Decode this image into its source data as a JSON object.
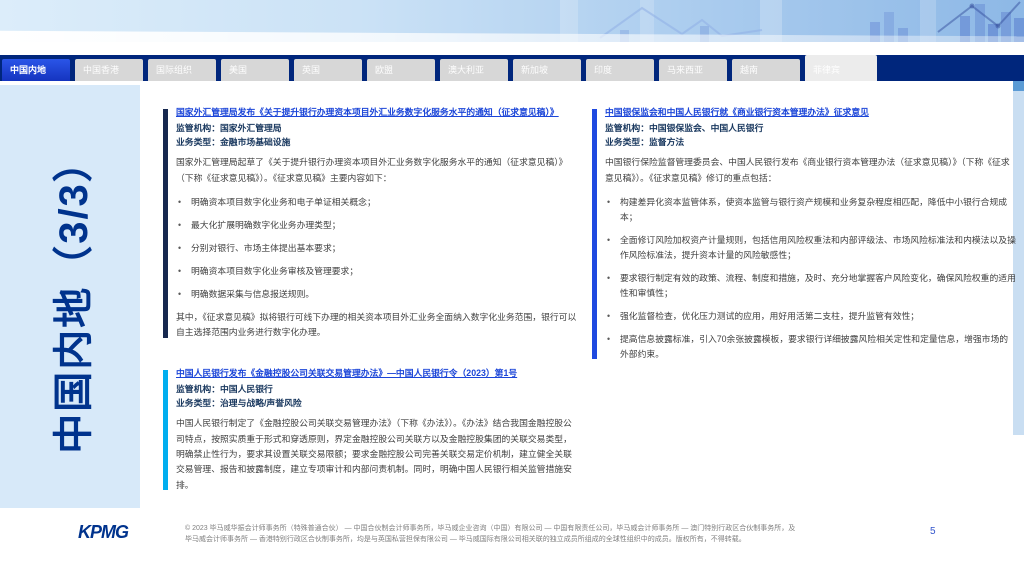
{
  "page": {
    "title_vertical": "中国内地（3/3）"
  },
  "tabs": [
    {
      "label": "中国内地",
      "active": true
    },
    {
      "label": "中国香港"
    },
    {
      "label": "国际组织"
    },
    {
      "label": "美国"
    },
    {
      "label": "英国"
    },
    {
      "label": "欧盟"
    },
    {
      "label": "澳大利亚"
    },
    {
      "label": "新加坡"
    },
    {
      "label": "印度"
    },
    {
      "label": "马来西亚"
    },
    {
      "label": "越南"
    },
    {
      "label": "菲律宾"
    }
  ],
  "labels": {
    "regulator": "监管机构：",
    "type": "业务类型："
  },
  "articles": {
    "left": [
      {
        "title": "国家外汇管理局发布《关于提升银行办理资本项目外汇业务数字化服务水平的通知（征求意见稿）》",
        "regulator": "国家外汇管理局",
        "type": "金融市场基础设施",
        "intro": "国家外汇管理局起草了《关于提升银行办理资本项目外汇业务数字化服务水平的通知（征求意见稿）》（下称《征求意见稿》）。《征求意见稿》主要内容如下：",
        "bullets": [
          "明确资本项目数字化业务和电子单证相关概念；",
          "最大化扩展明确数字化业务办理类型；",
          "分别对银行、市场主体提出基本要求；",
          "明确资本项目数字化业务审核及管理要求；",
          "明确数据采集与信息报送规则。"
        ],
        "outro": "其中，《征求意见稿》拟将银行可线下办理的相关资本项目外汇业务全面纳入数字化业务范围，银行可以自主选择范围内业务进行数字化办理。",
        "accent_color": "#16284f"
      },
      {
        "title": "中国人民银行发布《金融控股公司关联交易管理办法》—中国人民银行令（2023）第1号",
        "regulator": "中国人民银行",
        "type": "治理与战略/声誉风险",
        "intro": "中国人民银行制定了《金融控股公司关联交易管理办法》（下称《办法》）。《办法》结合我国金融控股公司特点，按照实质重于形式和穿透原则，界定金融控股公司关联方以及金融控股集团的关联交易类型，明确禁止性行为，要求其设置关联交易限额；要求金融控股公司完善关联交易定价机制，建立健全关联交易管理、报告和披露制度，建立专项审计和内部问责机制。同时，明确中国人民银行相关监管措施安排。",
        "accent_color": "#00aeef"
      }
    ],
    "right": [
      {
        "title": "中国银保监会和中国人民银行就《商业银行资本管理办法》征求意见",
        "regulator": "中国银保监会、中国人民银行",
        "type": "监督方法",
        "intro": "中国银行保险监督管理委员会、中国人民银行发布《商业银行资本管理办法（征求意见稿）》（下称《征求意见稿》）。《征求意见稿》修订的重点包括：",
        "bullets": [
          "构建差异化资本监管体系，使资本监管与银行资产规模和业务复杂程度相匹配，降低中小银行合规成本；",
          "全面修订风险加权资产计量规则，包括信用风险权重法和内部评级法、市场风险标准法和内模法以及操作风险标准法，提升资本计量的风险敏感性；",
          "要求银行制定有效的政策、流程、制度和措施，及时、充分地掌握客户风险变化，确保风险权重的适用性和审慎性；",
          "强化监督检查，优化压力测试的应用，用好用活第二支柱，提升监管有效性；",
          "提高信息披露标准，引入70余张披露模板，要求银行详细披露风险相关定性和定量信息，增强市场的外部约束。"
        ],
        "accent_color": "#1f49e0"
      }
    ]
  },
  "footer": {
    "logo": "KPMG",
    "copyright_line1": "© 2023 毕马威华振会计师事务所（特殊普通合伙） — 中国合伙制会计师事务所，毕马威企业咨询（中国）有限公司 — 中国有限责任公司，毕马威会计师事务所 — 澳门特别行政区合伙制事务所，及",
    "copyright_line2": "毕马威会计师事务所 — 香港特别行政区合伙制事务所，均是与英国私营担保有限公司 — 毕马威国际有限公司相关联的独立成员所组成的全球性组织中的成员。版权所有，不得转载。",
    "page_number": "5"
  },
  "colors": {
    "navbar": "#00267c",
    "active_tab": "#1d43d8",
    "inactive_tab": "#d7d7d7",
    "sidebar_bg": "#d7e9f9",
    "title_navy": "#00338d",
    "link_blue": "#1b45d8",
    "field_navy": "#17365d",
    "body_text": "#3f3f3f"
  }
}
